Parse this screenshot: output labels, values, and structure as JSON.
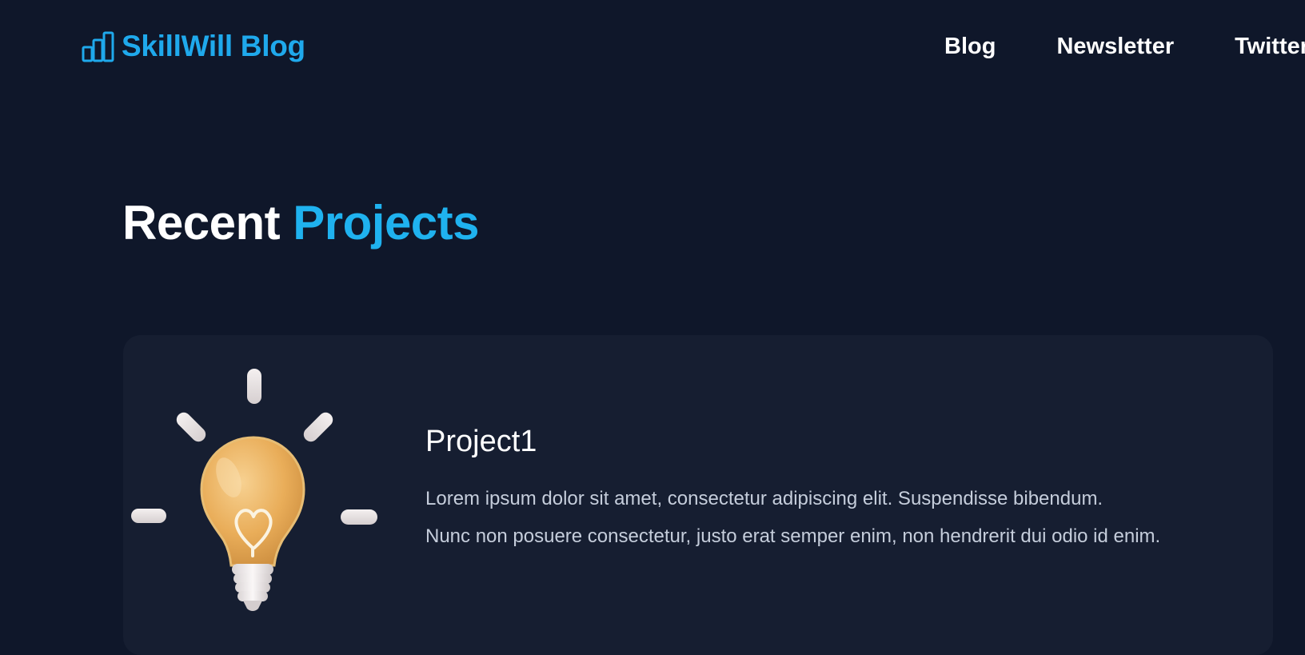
{
  "header": {
    "logo_text": "SkillWill Blog",
    "logo_icon": "bar-chart-icon",
    "nav": [
      "Blog",
      "Newsletter",
      "Twitter"
    ]
  },
  "section": {
    "title_prefix": "Recent",
    "title_accent": "Projects"
  },
  "project": {
    "icon": "lightbulb-icon",
    "title": "Project1",
    "description_line1": "Lorem ipsum dolor sit amet, consectetur adipiscing elit. Suspendisse bibendum.",
    "description_line2": "Nunc non posuere consectetur, justo erat semper enim, non hendrerit dui odio id enim."
  },
  "colors": {
    "background": "#0f172a",
    "card": "#161e31",
    "accent": "#1fa9ec",
    "text": "#ffffff",
    "muted_text": "#c5cddb"
  }
}
